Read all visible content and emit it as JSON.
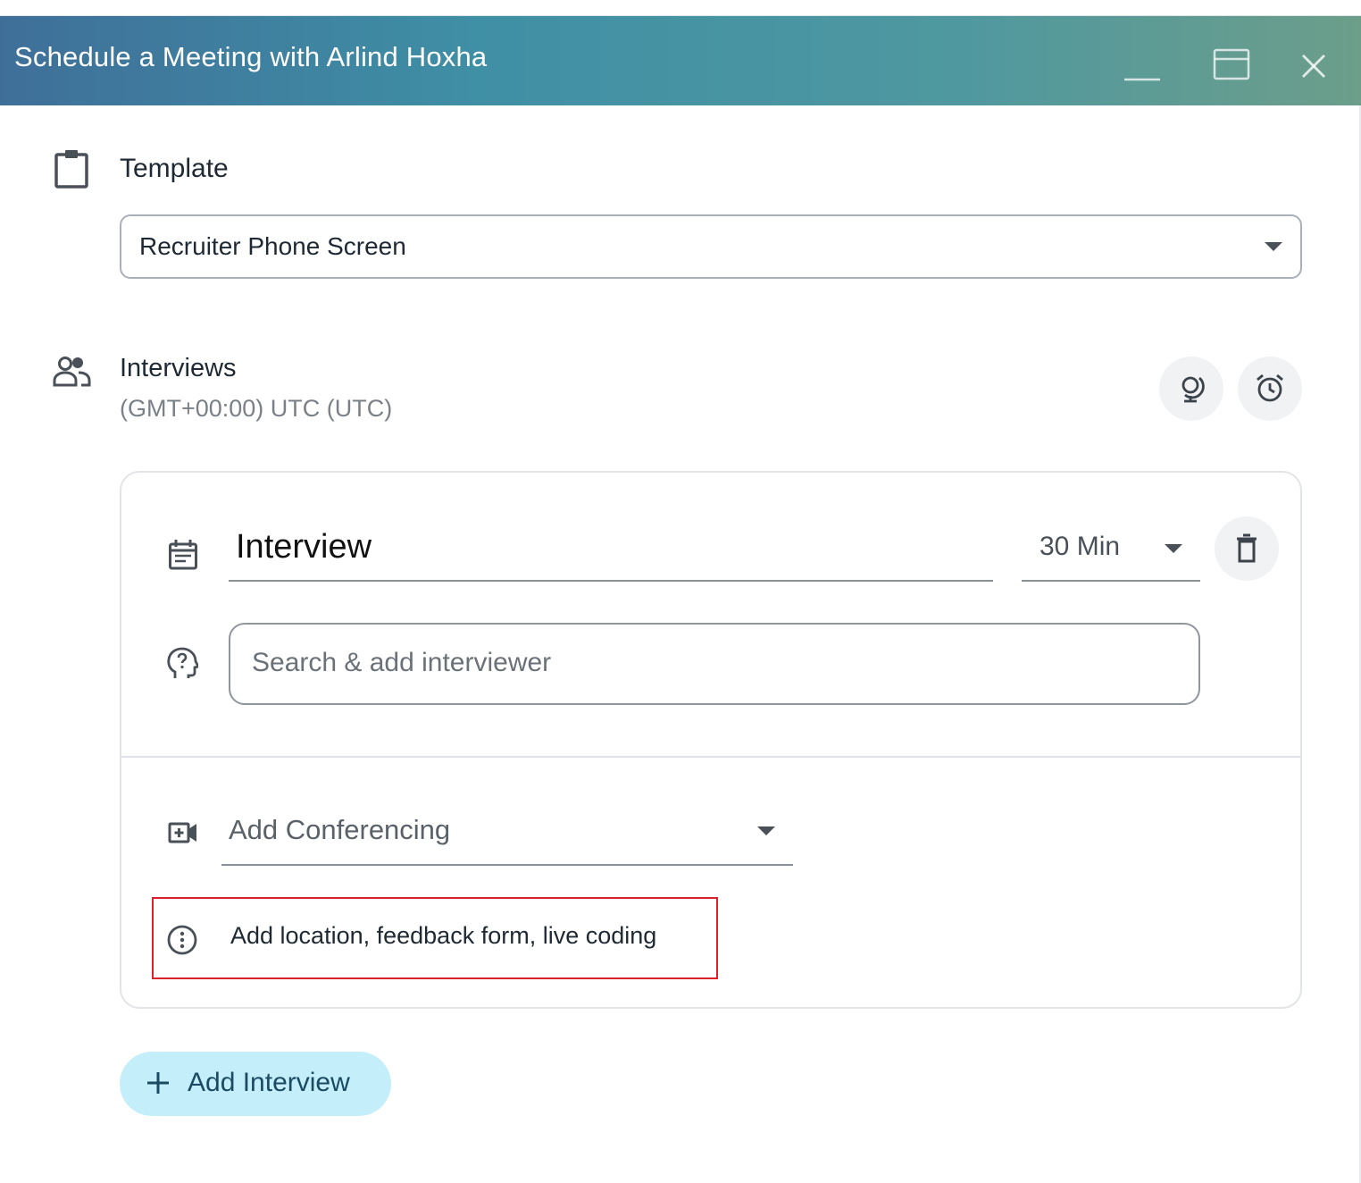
{
  "window": {
    "title": "Schedule a Meeting with Arlind Hoxha",
    "controls": [
      "minimize-icon",
      "maximize-icon",
      "close-icon"
    ]
  },
  "template": {
    "label": "Template",
    "selected": "Recruiter Phone Screen"
  },
  "interviews": {
    "label": "Interviews",
    "timezone": "(GMT+00:00) UTC (UTC)",
    "actions": [
      "globe-icon",
      "alarm-clock-icon"
    ],
    "items": [
      {
        "title": "Interview",
        "duration": "30 Min",
        "interviewer_placeholder": "Search & add interviewer",
        "conferencing": "Add Conferencing",
        "more_options": "Add location, feedback form, live coding"
      }
    ],
    "add_button": "Add Interview"
  },
  "colors": {
    "header_gradient_start": "#3f6f99",
    "header_gradient_end": "#6c9e8a",
    "add_button_bg": "#c4eef9",
    "highlight_border": "#d9222a"
  }
}
